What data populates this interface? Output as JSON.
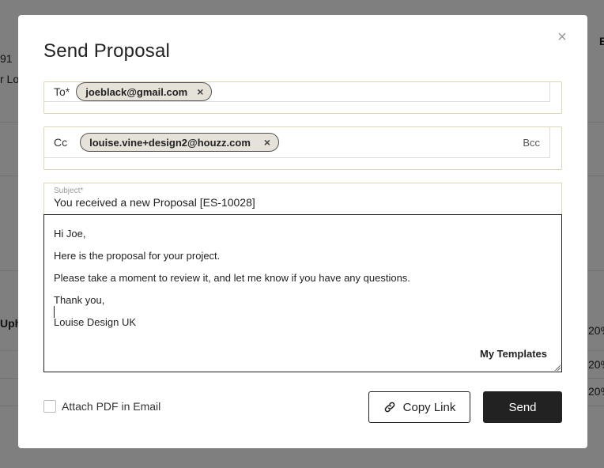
{
  "background": {
    "fragments": [
      "91",
      "r Lo",
      "E",
      "Uph",
      "20%",
      "20%",
      "20%"
    ]
  },
  "modal": {
    "title": "Send Proposal",
    "close_glyph": "×",
    "to": {
      "label": "To*",
      "recipient": "joeblack@gmail.com",
      "remove_glyph": "×"
    },
    "cc": {
      "label": "Cc",
      "recipient": "louise.vine+design2@houzz.com",
      "remove_glyph": "×",
      "bcc_label": "Bcc"
    },
    "subject": {
      "label": "Subject*",
      "value": "You received a new Proposal [ES-10028]"
    },
    "body": {
      "lines": [
        "Hi Joe,",
        "Here is the proposal for your project.",
        "Please take a moment to review it, and let me know if you have any questions.",
        "Thank you,",
        "Louise Design UK"
      ],
      "templates_label": "My Templates"
    },
    "attach_pdf_label": "Attach PDF in Email",
    "attach_pdf_checked": false,
    "copy_link_label": "Copy Link",
    "send_label": "Send"
  }
}
